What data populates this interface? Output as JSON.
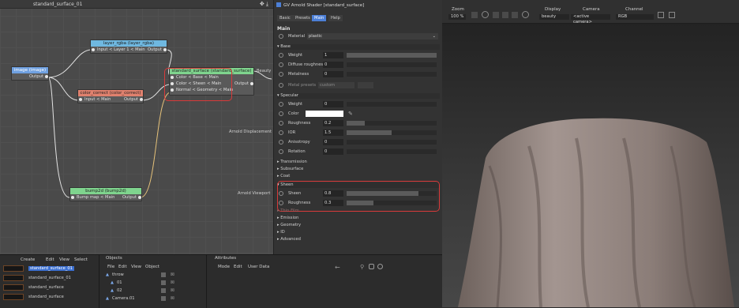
{
  "node_editor": {
    "title": "standard_surface_01",
    "nodes": {
      "image": {
        "title": "image (image)",
        "out": "Output"
      },
      "layer_rgba": {
        "title": "layer_rgba (layer_rgba)",
        "row": "Input < Layer 1 < Main",
        "out": "Output"
      },
      "color_correct": {
        "title": "color_correct (color_correct)",
        "row": "Input < Main",
        "out": "Output"
      },
      "standard_surface": {
        "title": "standard_surface (standard_surface)",
        "rows": [
          "Color < Base < Main",
          "Color < Sheen < Main",
          "Normal < Geometry < Main"
        ],
        "out": "Output"
      },
      "bump2d": {
        "title": "bump2d (bump2d)",
        "row": "Bump map < Main",
        "out": "Output"
      }
    },
    "side_labels": {
      "beauty": "Beauty",
      "displacement": "Arnold Displacement",
      "viewport": "Arnold Viewport"
    }
  },
  "attributes": {
    "title": "GV Arnold Shader [standard_surface]",
    "tabs": [
      "Basic",
      "Presets",
      "Main",
      "Help"
    ],
    "active_tab": "Main",
    "section": "Main",
    "material_label": "Material",
    "material_value": "plastic",
    "base": {
      "label": "Base",
      "rows": [
        {
          "label": "Weight",
          "value": "1",
          "fill": 1.0
        },
        {
          "label": "Diffuse roughness",
          "value": "0",
          "fill": 0
        },
        {
          "label": "Metalness",
          "value": "0",
          "fill": 0
        }
      ],
      "metal_presets": "Metal presets",
      "metal_presets_value": "custom"
    },
    "specular": {
      "label": "Specular",
      "rows": [
        {
          "label": "Weight",
          "value": "0",
          "fill": 0
        },
        {
          "label": "Color",
          "value": "",
          "fill": 0
        },
        {
          "label": "Roughness",
          "value": "0.2",
          "fill": 0.2
        },
        {
          "label": "IOR",
          "value": "1.5",
          "fill": 0.5
        },
        {
          "label": "Anisotropy",
          "value": "0",
          "fill": 0
        },
        {
          "label": "Rotation",
          "value": "0",
          "fill": 0
        }
      ]
    },
    "collapsed_a": [
      "Transmission",
      "Subsurface",
      "Coat"
    ],
    "sheen": {
      "label": "Sheen",
      "rows": [
        {
          "label": "Sheen",
          "value": "0.8",
          "fill": 0.8
        },
        {
          "label": "Roughness",
          "value": "0.3",
          "fill": 0.3
        }
      ]
    },
    "collapsed_b": [
      "Thin Film",
      "Emission",
      "Geometry",
      "ID",
      "Advanced"
    ]
  },
  "viewport": {
    "zoom_label": "Zoom",
    "zoom_value": "100 %",
    "display_label": "Display",
    "display_value": "beauty",
    "camera_label": "Camera",
    "camera_value": "<active camera>",
    "channel_label": "Channel",
    "channel_value": "RGB"
  },
  "materials_panel": {
    "menu": [
      "Create",
      "Edit",
      "View",
      "Select"
    ],
    "items": [
      "standard_surface_01",
      "standard_surface_01",
      "standard_surface",
      "standard_surface"
    ]
  },
  "objects_panel": {
    "title": "Objects",
    "menu": [
      "File",
      "Edit",
      "View",
      "Object"
    ],
    "items": [
      "throw",
      "01",
      "02",
      "Camera.01"
    ]
  },
  "attributes_panel": {
    "title": "Attributes",
    "menu": [
      "Mode",
      "Edit",
      "User Data"
    ]
  }
}
